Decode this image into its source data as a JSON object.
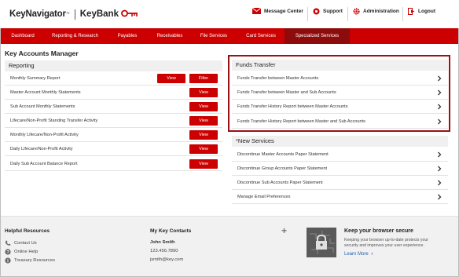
{
  "header": {
    "logo_keynavigator": "KeyNavigator",
    "logo_tm": "™",
    "logo_keybank": "KeyBank",
    "links": [
      {
        "label": "Message Center",
        "icon": "envelope-icon"
      },
      {
        "label": "Support",
        "icon": "lifebuoy-icon"
      },
      {
        "label": "Administration",
        "icon": "gear-icon"
      },
      {
        "label": "Logout",
        "icon": "logout-icon"
      }
    ]
  },
  "nav": {
    "tabs": [
      "Dashboard",
      "Reporting & Research",
      "Payables",
      "Receivables",
      "File Services",
      "Card Services",
      "Specialized Services"
    ],
    "active": "Specialized Services"
  },
  "page": {
    "title": "Key Accounts Manager"
  },
  "reporting": {
    "title": "Reporting",
    "view_label": "View",
    "filter_label": "Filter",
    "rows": [
      "Monthly Summary Report",
      "Master Account Monthly Statements",
      "Sub Account Monthly Statements",
      "Lifecare/Non-Profit Standing Transfer Activity",
      "Monthly Lifecare/Non-Profit Activity",
      "Daily Lifecare/Non-Profit Activity",
      "Daily Sub Account Balance Report"
    ]
  },
  "funds_transfer": {
    "title": "Funds Transfer",
    "rows": [
      "Funds Transfer between Master Accounts",
      "Funds Transfer between Master and Sub Accounts",
      "Funds Transfer History Report between Master Accounts",
      "Funds Transfer History Report between Master and Sub Accounts"
    ]
  },
  "new_services": {
    "title": "*New Services",
    "rows": [
      "Discontinue Master Accounts Paper Statement",
      "Discontinue Group Accounts Paper Statement",
      "Discontinue Sub Accounts Paper Statement",
      "Manage Email Preferences"
    ]
  },
  "footer": {
    "helpful_title": "Helpful Resources",
    "helpful_items": [
      {
        "label": "Contact Us",
        "icon": "phone-icon"
      },
      {
        "label": "Online Help",
        "icon": "help-icon"
      },
      {
        "label": "Treasury Resources",
        "icon": "info-icon"
      }
    ],
    "contacts_title": "My Key Contacts",
    "contact_name": "John Smith",
    "contact_phone": "123.456.7890",
    "contact_email": "jsmith@key.com",
    "secure_title": "Keep your browser secure",
    "secure_text": "Keeping your browser up-to-date protects your security and improves your user experience.",
    "learn_more": "Learn More"
  },
  "colors": {
    "brand_red": "#cc0000",
    "active_tab": "#8d0b0b",
    "highlight": "#9b1015"
  }
}
